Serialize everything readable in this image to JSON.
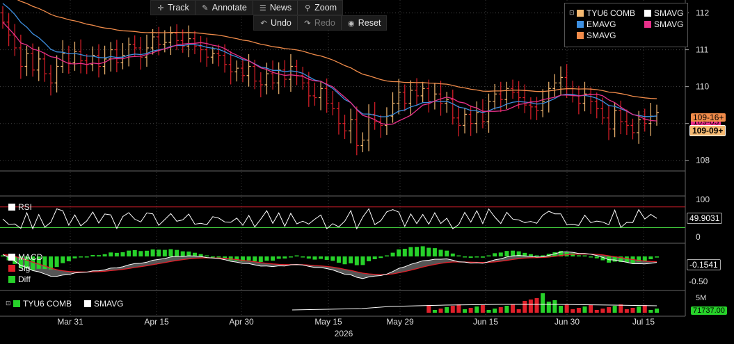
{
  "toolbar": {
    "track": "Track",
    "annotate": "Annotate",
    "news": "News",
    "zoom": "Zoom",
    "undo": "Undo",
    "redo": "Redo",
    "reset": "Reset"
  },
  "legend": {
    "items": [
      {
        "label": "TYU6 COMB",
        "color": "#f5b971"
      },
      {
        "label": "SMAVG",
        "color": "#ffffff"
      },
      {
        "label": "EMAVG",
        "color": "#3d8fe0"
      },
      {
        "label": "SMAVG",
        "color": "#e8308a"
      },
      {
        "label": "SMAVG",
        "color": "#f08b4a"
      }
    ]
  },
  "panels": {
    "rsi": {
      "label": "RSI",
      "value": "49.9031",
      "ticks": [
        "100",
        "0"
      ]
    },
    "macd": {
      "labels": [
        "MACD",
        "Sig",
        "Diff"
      ],
      "value": "-0.1541",
      "ticks": [
        "-0.50"
      ]
    },
    "volume": {
      "labels": [
        "TYU6 COMB",
        "SMAVG"
      ],
      "value": "71737.00",
      "ticks": [
        "5M"
      ]
    }
  },
  "price_tags": {
    "last": "109-09+",
    "sma_orange": "109-16+",
    "sma_pink": "109-03"
  },
  "colors": {
    "up": "#f5b971",
    "down": "#e0202a",
    "ema": "#3d8fe0",
    "sma_fast": "#e8308a",
    "sma_slow": "#f08b4a",
    "rsi": "#ffffff",
    "overbought": "#d21e2a",
    "oversold": "#41c83c",
    "macd": "#ffffff",
    "sig": "#e0202a",
    "diff": "#27d22a"
  },
  "chart_data": {
    "type": "line",
    "series_name": "TYU6 COMB",
    "x_ticks": [
      "Mar 31",
      "Apr 15",
      "Apr 30",
      "May 15",
      "May 29",
      "Jun 15",
      "Jun 30",
      "Jul 15"
    ],
    "x_year": "2026",
    "y_ticks": [
      "112",
      "111",
      "110",
      "109",
      "108"
    ],
    "y_range": [
      107.75,
      112.35
    ],
    "bars": [
      {
        "c": 111.75
      },
      {
        "c": 111.4
      },
      {
        "c": 111.05
      },
      {
        "c": 110.55
      },
      {
        "c": 110.9
      },
      {
        "c": 110.45
      },
      {
        "c": 110.75
      },
      {
        "c": 110.35
      },
      {
        "c": 110.1
      },
      {
        "c": 110.55
      },
      {
        "c": 110.9
      },
      {
        "c": 110.65
      },
      {
        "c": 110.95
      },
      {
        "c": 110.7
      },
      {
        "c": 110.6
      },
      {
        "c": 110.85
      },
      {
        "c": 110.55
      },
      {
        "c": 110.75
      },
      {
        "c": 111.0
      },
      {
        "c": 110.65
      },
      {
        "c": 110.85
      },
      {
        "c": 111.15
      },
      {
        "c": 111.05
      },
      {
        "c": 110.8
      },
      {
        "c": 111.05
      },
      {
        "c": 111.35
      },
      {
        "c": 111.15
      },
      {
        "c": 111.2
      },
      {
        "c": 111.45
      },
      {
        "c": 111.25
      },
      {
        "c": 111.1
      },
      {
        "c": 111.3
      },
      {
        "c": 111.1
      },
      {
        "c": 111.0
      },
      {
        "c": 110.8
      },
      {
        "c": 110.9
      },
      {
        "c": 110.85
      },
      {
        "c": 110.6
      },
      {
        "c": 110.4
      },
      {
        "c": 110.5
      },
      {
        "c": 110.3
      },
      {
        "c": 110.55
      },
      {
        "c": 110.15
      },
      {
        "c": 110.05
      },
      {
        "c": 110.35
      },
      {
        "c": 110.1
      },
      {
        "c": 110.45
      },
      {
        "c": 110.2
      },
      {
        "c": 110.55
      },
      {
        "c": 110.3
      },
      {
        "c": 110.1
      },
      {
        "c": 109.75
      },
      {
        "c": 109.7
      },
      {
        "c": 109.95
      },
      {
        "c": 109.55
      },
      {
        "c": 109.4
      },
      {
        "c": 109.0
      },
      {
        "c": 108.8
      },
      {
        "c": 109.1
      },
      {
        "c": 108.4
      },
      {
        "c": 108.55
      },
      {
        "c": 109.25
      },
      {
        "c": 109.05
      },
      {
        "c": 108.95
      },
      {
        "c": 109.2
      },
      {
        "c": 109.55
      },
      {
        "c": 109.85
      },
      {
        "c": 109.55
      },
      {
        "c": 109.9
      },
      {
        "c": 109.75
      },
      {
        "c": 109.95
      },
      {
        "c": 109.6
      },
      {
        "c": 109.8
      },
      {
        "c": 109.55
      },
      {
        "c": 109.65
      },
      {
        "c": 109.15
      },
      {
        "c": 108.95
      },
      {
        "c": 109.25
      },
      {
        "c": 109.0
      },
      {
        "c": 109.3
      },
      {
        "c": 109.05
      },
      {
        "c": 109.6
      },
      {
        "c": 109.8
      },
      {
        "c": 109.65
      },
      {
        "c": 109.95
      },
      {
        "c": 109.85
      },
      {
        "c": 109.7
      },
      {
        "c": 109.5
      },
      {
        "c": 109.45
      },
      {
        "c": 109.35
      },
      {
        "c": 109.6
      },
      {
        "c": 109.95
      },
      {
        "c": 110.1
      },
      {
        "c": 110.25
      },
      {
        "c": 109.95
      },
      {
        "c": 109.75
      },
      {
        "c": 109.55
      },
      {
        "c": 109.8
      },
      {
        "c": 109.6
      },
      {
        "c": 109.4
      },
      {
        "c": 109.15
      },
      {
        "c": 108.85
      },
      {
        "c": 109.35
      },
      {
        "c": 109.05
      },
      {
        "c": 108.95
      },
      {
        "c": 108.75
      },
      {
        "c": 109.1
      },
      {
        "c": 109.0
      },
      {
        "c": 109.2
      },
      {
        "c": 109.3
      }
    ]
  }
}
